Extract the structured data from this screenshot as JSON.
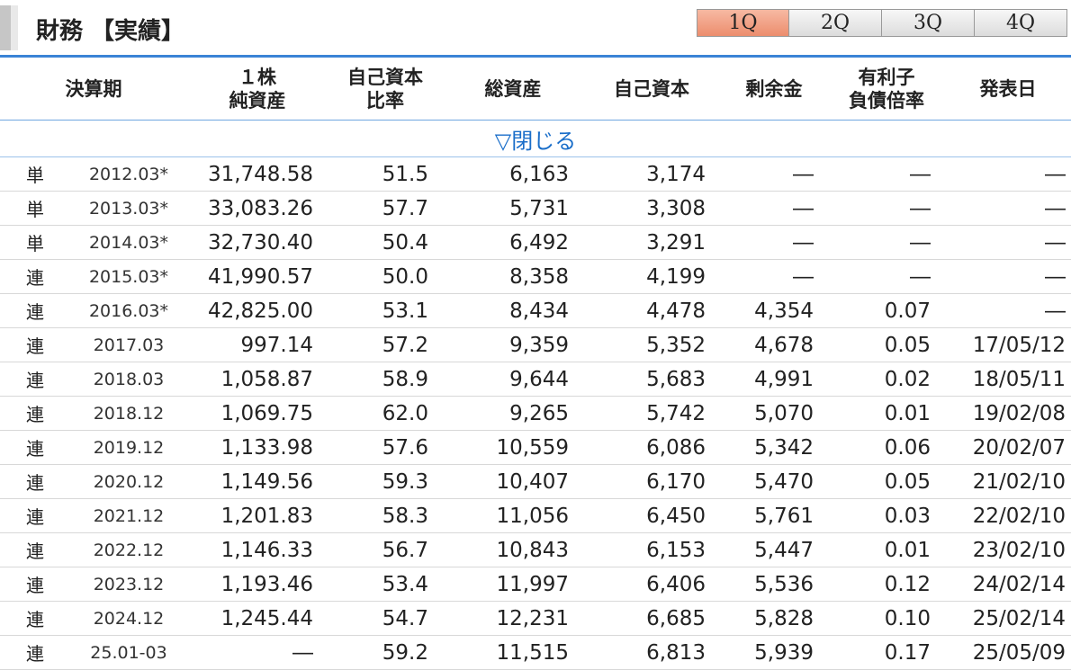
{
  "header": {
    "title": "財務 【実績】",
    "tabs": [
      {
        "label": "1Q",
        "active": true
      },
      {
        "label": "2Q",
        "active": false
      },
      {
        "label": "3Q",
        "active": false
      },
      {
        "label": "4Q",
        "active": false
      }
    ]
  },
  "table": {
    "columns": [
      {
        "line1": "決算期",
        "line2": ""
      },
      {
        "line1": "１株",
        "line2": "純資産"
      },
      {
        "line1": "自己資本",
        "line2": "比率"
      },
      {
        "line1": "総資産",
        "line2": ""
      },
      {
        "line1": "自己資本",
        "line2": ""
      },
      {
        "line1": "剰余金",
        "line2": ""
      },
      {
        "line1": "有利子",
        "line2": "負債倍率"
      },
      {
        "line1": "発表日",
        "line2": ""
      }
    ],
    "toggle_label": "▽閉じる",
    "rows": [
      {
        "type": "単",
        "period": "2012.03*",
        "bps": "31,748.58",
        "equity_ratio": "51.5",
        "total_assets": "6,163",
        "equity": "3,174",
        "surplus": "―",
        "de_ratio": "―",
        "announce": "―"
      },
      {
        "type": "単",
        "period": "2013.03*",
        "bps": "33,083.26",
        "equity_ratio": "57.7",
        "total_assets": "5,731",
        "equity": "3,308",
        "surplus": "―",
        "de_ratio": "―",
        "announce": "―"
      },
      {
        "type": "単",
        "period": "2014.03*",
        "bps": "32,730.40",
        "equity_ratio": "50.4",
        "total_assets": "6,492",
        "equity": "3,291",
        "surplus": "―",
        "de_ratio": "―",
        "announce": "―"
      },
      {
        "type": "連",
        "period": "2015.03*",
        "bps": "41,990.57",
        "equity_ratio": "50.0",
        "total_assets": "8,358",
        "equity": "4,199",
        "surplus": "―",
        "de_ratio": "―",
        "announce": "―"
      },
      {
        "type": "連",
        "period": "2016.03*",
        "bps": "42,825.00",
        "equity_ratio": "53.1",
        "total_assets": "8,434",
        "equity": "4,478",
        "surplus": "4,354",
        "de_ratio": "0.07",
        "announce": "―"
      },
      {
        "type": "連",
        "period": "2017.03",
        "bps": "997.14",
        "equity_ratio": "57.2",
        "total_assets": "9,359",
        "equity": "5,352",
        "surplus": "4,678",
        "de_ratio": "0.05",
        "announce": "17/05/12"
      },
      {
        "type": "連",
        "period": "2018.03",
        "bps": "1,058.87",
        "equity_ratio": "58.9",
        "total_assets": "9,644",
        "equity": "5,683",
        "surplus": "4,991",
        "de_ratio": "0.02",
        "announce": "18/05/11"
      },
      {
        "type": "連",
        "period": "2018.12",
        "bps": "1,069.75",
        "equity_ratio": "62.0",
        "total_assets": "9,265",
        "equity": "5,742",
        "surplus": "5,070",
        "de_ratio": "0.01",
        "announce": "19/02/08"
      },
      {
        "type": "連",
        "period": "2019.12",
        "bps": "1,133.98",
        "equity_ratio": "57.6",
        "total_assets": "10,559",
        "equity": "6,086",
        "surplus": "5,342",
        "de_ratio": "0.06",
        "announce": "20/02/07"
      },
      {
        "type": "連",
        "period": "2020.12",
        "bps": "1,149.56",
        "equity_ratio": "59.3",
        "total_assets": "10,407",
        "equity": "6,170",
        "surplus": "5,470",
        "de_ratio": "0.05",
        "announce": "21/02/10"
      },
      {
        "type": "連",
        "period": "2021.12",
        "bps": "1,201.83",
        "equity_ratio": "58.3",
        "total_assets": "11,056",
        "equity": "6,450",
        "surplus": "5,761",
        "de_ratio": "0.03",
        "announce": "22/02/10"
      },
      {
        "type": "連",
        "period": "2022.12",
        "bps": "1,146.33",
        "equity_ratio": "56.7",
        "total_assets": "10,843",
        "equity": "6,153",
        "surplus": "5,447",
        "de_ratio": "0.01",
        "announce": "23/02/10"
      },
      {
        "type": "連",
        "period": "2023.12",
        "bps": "1,193.46",
        "equity_ratio": "53.4",
        "total_assets": "11,997",
        "equity": "6,406",
        "surplus": "5,536",
        "de_ratio": "0.12",
        "announce": "24/02/14"
      },
      {
        "type": "連",
        "period": "2024.12",
        "bps": "1,245.44",
        "equity_ratio": "54.7",
        "total_assets": "12,231",
        "equity": "6,685",
        "surplus": "5,828",
        "de_ratio": "0.10",
        "announce": "25/02/14"
      },
      {
        "type": "連",
        "period": "25.01-03",
        "bps": "―",
        "equity_ratio": "59.2",
        "total_assets": "11,515",
        "equity": "6,813",
        "surplus": "5,939",
        "de_ratio": "0.17",
        "announce": "25/05/09"
      }
    ]
  },
  "colors": {
    "accent_blue": "#3a83d6",
    "link_blue": "#1a6ec9",
    "active_tab": "#ec8d6d"
  }
}
